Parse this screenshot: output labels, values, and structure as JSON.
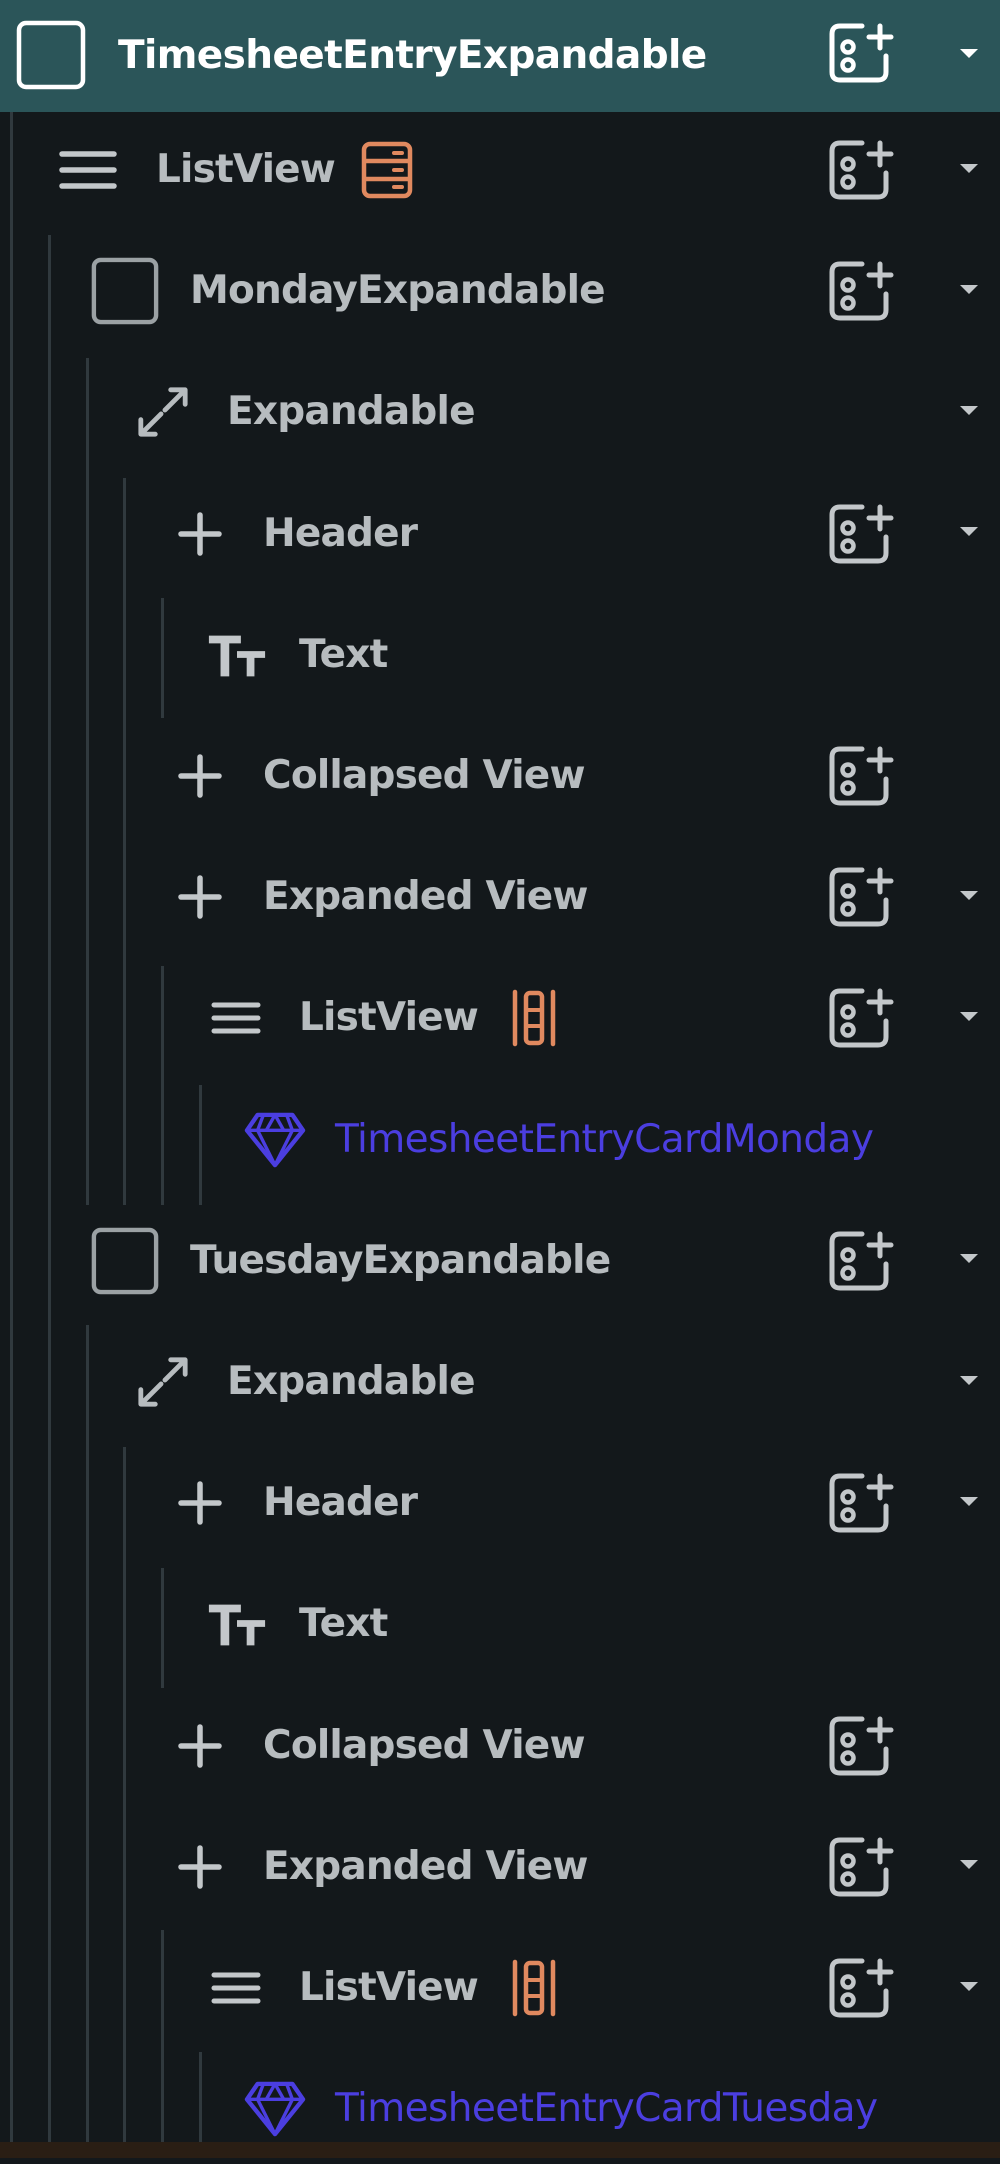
{
  "colors": {
    "root_background": "#2b5559",
    "panel_background": "#13181b",
    "label_text": "#b7bcbf",
    "root_label_text": "#ffffff",
    "component_text": "#4b3ee0",
    "accent_orange": "#e0895f",
    "guide_line": "#30393e"
  },
  "tree": {
    "root": {
      "label": "TimesheetEntryExpandable",
      "icon": "container-icon"
    },
    "nodes": [
      {
        "label": "ListView",
        "icon": "list-icon",
        "badge": "rows-badge-icon"
      },
      {
        "label": "MondayExpandable",
        "icon": "container-icon"
      },
      {
        "label": "Expandable",
        "icon": "expand-arrows-icon"
      },
      {
        "label": "Header",
        "icon": "plus-icon"
      },
      {
        "label": "Text",
        "icon": "text-icon"
      },
      {
        "label": "Collapsed View",
        "icon": "plus-icon"
      },
      {
        "label": "Expanded View",
        "icon": "plus-icon"
      },
      {
        "label": "ListView",
        "icon": "list-icon",
        "badge": "columns-badge-icon"
      },
      {
        "label": "TimesheetEntryCardMonday",
        "icon": "component-gem-icon"
      },
      {
        "label": "TuesdayExpandable",
        "icon": "container-icon"
      },
      {
        "label": "Expandable",
        "icon": "expand-arrows-icon"
      },
      {
        "label": "Header",
        "icon": "plus-icon"
      },
      {
        "label": "Text",
        "icon": "text-icon"
      },
      {
        "label": "Collapsed View",
        "icon": "plus-icon"
      },
      {
        "label": "Expanded View",
        "icon": "plus-icon"
      },
      {
        "label": "ListView",
        "icon": "list-icon",
        "badge": "columns-badge-icon"
      },
      {
        "label": "TimesheetEntryCardTuesday",
        "icon": "component-gem-icon"
      }
    ]
  }
}
